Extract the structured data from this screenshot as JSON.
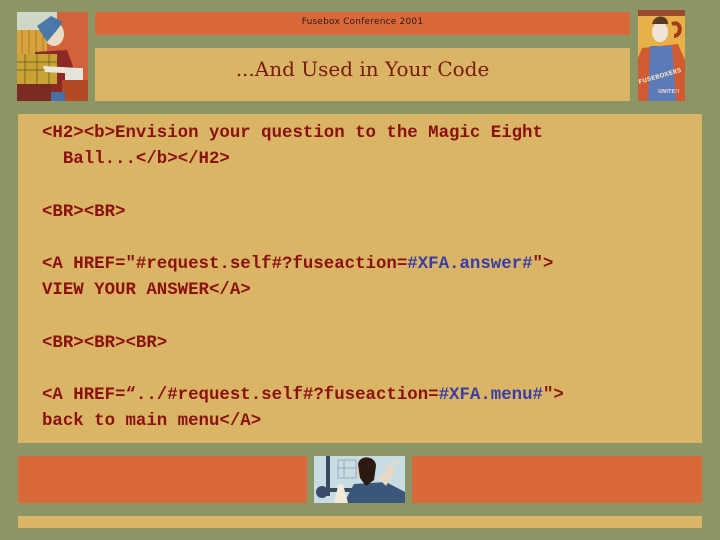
{
  "header": {
    "conference_label": "Fusebox Conference 2001",
    "slide_title": "...And Used in Your Code",
    "left_illustration": "worker-woman-illustration",
    "right_illustration": "fuseboxers-unite-poster",
    "right_poster_text_1": "FUSEBOXERS",
    "right_poster_text_2": "UNITE!!"
  },
  "code_block": {
    "line1a": "<H2><b>Envision your question to the Magic Eight",
    "line1b": "  Ball...</b></H2>",
    "line2": "<BR><BR>",
    "line3_prefix": "<A HREF=\"#request.self#?fuseaction=",
    "line3_var": "#XFA.answer#",
    "line3_suffix": "\">",
    "line4": "VIEW YOUR ANSWER</A>",
    "line5": "<BR><BR><BR>",
    "line6_prefix": "<A HREF=“../#request.self#?fuseaction=",
    "line6_var": "#XFA.menu#",
    "line6_suffix": "\">",
    "line7": "back to main menu</A>"
  },
  "footer": {
    "illustration": "bearded-man-at-blackboard-illustration"
  },
  "colors": {
    "background": "#8c9665",
    "accent_orange": "#d9693a",
    "panel_tan": "#d9b565",
    "code_text": "#8b1010",
    "code_variable": "#3c3ca8",
    "title_text": "#7a1a10"
  }
}
